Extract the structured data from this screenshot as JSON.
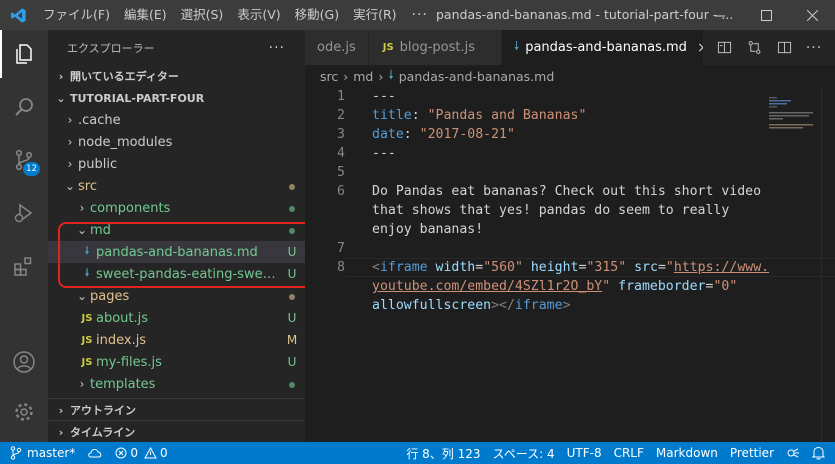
{
  "titlebar": {
    "menu": [
      "ファイル(F)",
      "編集(E)",
      "選択(S)",
      "表示(V)",
      "移動(G)",
      "実行(R)"
    ],
    "more": "···",
    "title": "pandas-and-bananas.md - tutorial-part-four - ..."
  },
  "activity": {
    "scm_badge": "12"
  },
  "sidebar": {
    "title": "エクスプローラー",
    "more": "···",
    "open_editors": "開いているエディター",
    "project": "TUTORIAL-PART-FOUR",
    "tree": [
      {
        "label": ".cache",
        "chev": "›",
        "deco": ""
      },
      {
        "label": "node_modules",
        "chev": "›",
        "deco": ""
      },
      {
        "label": "public",
        "chev": "›",
        "deco": ""
      },
      {
        "label": "src",
        "chev": "⌄",
        "deco": "dot-olive"
      },
      {
        "label": "components",
        "chev": "›",
        "deco": "dot-green"
      },
      {
        "label": "md",
        "chev": "⌄",
        "deco": "dot-green"
      },
      {
        "label": "pandas-and-bananas.md",
        "deco": "U"
      },
      {
        "label": "sweet-pandas-eating-sweets....",
        "deco": "U"
      },
      {
        "label": "pages",
        "chev": "⌄",
        "deco": "dot-olive"
      },
      {
        "label": "about.js",
        "deco": "U"
      },
      {
        "label": "index.js",
        "deco": "M"
      },
      {
        "label": "my-files.js",
        "deco": "U"
      },
      {
        "label": "templates",
        "chev": "›",
        "deco": "dot-green"
      }
    ],
    "outline": "アウトライン",
    "timeline": "タイムライン"
  },
  "tabs": [
    {
      "label": "ode.js",
      "icon": ""
    },
    {
      "label": "blog-post.js",
      "icon": "JS"
    },
    {
      "label": "pandas-and-bananas.md",
      "icon": "md",
      "close": "×"
    }
  ],
  "breadcrumb": [
    "src",
    "md",
    "pandas-and-bananas.md"
  ],
  "editor": {
    "line_numbers": [
      "1",
      "2",
      "3",
      "4",
      "5",
      "6",
      "",
      "",
      "7",
      "8",
      "",
      ""
    ]
  },
  "status": {
    "branch": "master*",
    "errors": "0",
    "warnings": "0",
    "position": "行 8、列 123",
    "spaces": "スペース: 4",
    "encoding": "UTF-8",
    "eol": "CRLF",
    "language": "Markdown",
    "formatter": "Prettier"
  },
  "colors": {
    "accent": "#007acc",
    "untracked": "#73c991",
    "modified": "#e2c08d",
    "highlight": "#e0241c"
  }
}
